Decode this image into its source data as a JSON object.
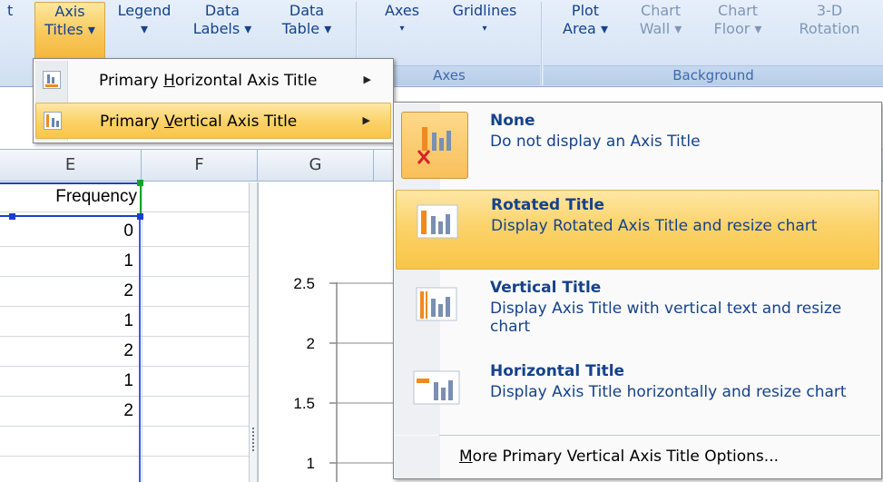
{
  "ribbon": {
    "buttons": [
      {
        "top": "t",
        "bottom": ""
      },
      {
        "top": "Axis",
        "bottom": "Titles ▾"
      },
      {
        "top": "Legend",
        "bottom": "▾"
      },
      {
        "top": "Data",
        "bottom": "Labels ▾"
      },
      {
        "top": "Data",
        "bottom": "Table ▾"
      },
      {
        "top": "Axes",
        "bottom": "▾"
      },
      {
        "top": "Gridlines",
        "bottom": "▾"
      },
      {
        "top": "Plot",
        "bottom": "Area ▾"
      },
      {
        "top": "Chart",
        "bottom": "Wall ▾"
      },
      {
        "top": "Chart",
        "bottom": "Floor ▾"
      },
      {
        "top": "3-D",
        "bottom": "Rotation"
      }
    ],
    "groups": {
      "axes": "Axes",
      "background": "Background"
    }
  },
  "columns": [
    "E",
    "F",
    "G"
  ],
  "cells": {
    "header": "Frequency",
    "values": [
      "0",
      "1",
      "2",
      "1",
      "2",
      "1",
      "2",
      ""
    ]
  },
  "chart_data": {
    "type": "line",
    "y_ticks": [
      "2.5",
      "2",
      "1.5",
      "1"
    ]
  },
  "menu_axis_titles": {
    "items": [
      {
        "pre": "Primary ",
        "accel": "H",
        "post": "orizontal Axis Title"
      },
      {
        "pre": "Primary ",
        "accel": "V",
        "post": "ertical Axis Title"
      }
    ]
  },
  "menu_vertical": {
    "options": [
      {
        "title": "None",
        "desc": "Do not display an Axis Title"
      },
      {
        "title": "Rotated Title",
        "desc": "Display Rotated Axis Title and resize chart"
      },
      {
        "title": "Vertical Title",
        "desc": "Display Axis Title with vertical text and resize chart"
      },
      {
        "title": "Horizontal Title",
        "desc": "Display Axis Title horizontally and resize chart"
      }
    ],
    "more": {
      "accel": "M",
      "rest": "ore Primary Vertical Axis Title Options..."
    }
  },
  "colors": {
    "accent": "#15428b",
    "highlight": "#fbd36a",
    "selection": "#1a3fd0"
  }
}
